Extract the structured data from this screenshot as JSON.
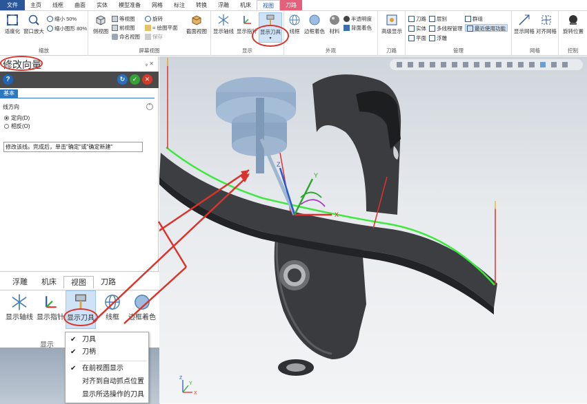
{
  "menu": {
    "tabs": [
      "文件",
      "主页",
      "线框",
      "曲面",
      "实体",
      "模型准备",
      "网格",
      "标注",
      "转换",
      "浮雕",
      "机床",
      "视图",
      "刀路"
    ],
    "active": "视图"
  },
  "ribbon": {
    "zoom": {
      "name": "缩放",
      "fit": "适度化",
      "window_zoom": "窗口放大",
      "shrink50": "缩小 50%",
      "shrink80": "缩小图形 80%"
    },
    "screen_view": {
      "name": "屏幕视图",
      "side": "侧视图",
      "iso": "等视图",
      "front": "前视图",
      "named": "命名视图",
      "rotate": "旋转",
      "plane": "= 绘图平面",
      "save": "保存",
      "section": "截面视图"
    },
    "display": {
      "name": "显示",
      "axis": "显示轴线",
      "indicator": "显示指针",
      "tool": "显示刀具"
    },
    "appearance": {
      "name": "外观",
      "wire": "线框",
      "edge_shade": "边框着色",
      "material": "材料",
      "translucent": "半透明度",
      "back_color": "背面着色"
    },
    "toolpath": {
      "name": "刀路",
      "advanced": "高级显示"
    },
    "manage": {
      "name": "管理",
      "toolpath": "刀路",
      "solid": "实体",
      "plane": "平面",
      "layer": "层别",
      "multi": "多线程管理",
      "relief": "浮雕",
      "group": "群组",
      "recent": "最近使用功能"
    },
    "grid": {
      "name": "网格",
      "show": "显示网格",
      "align": "对齐网格"
    },
    "control": {
      "name": "控制",
      "rotate_pos": "旋转位置"
    }
  },
  "panel": {
    "title": "修改向量",
    "pin": "ᵩ ✕",
    "tab": "基本",
    "section": "线方向",
    "opt1": "定向(D)",
    "opt2": "相反(O)",
    "hint": "修改该线。完成后，单击\"确定\"或\"确定新建\""
  },
  "inset": {
    "tabs": [
      "浮雕",
      "机床",
      "视图",
      "刀路"
    ],
    "active": "视图",
    "btn_axis": "显示轴线",
    "btn_indicator": "显示指针",
    "btn_tool": "显示刀具",
    "btn_wire": "线框",
    "btn_edge": "边框着色",
    "group": "显示"
  },
  "dropdown": {
    "items": [
      {
        "label": "刀具",
        "checked": true
      },
      {
        "label": "刀柄",
        "checked": true
      },
      {
        "label": "在前视图显示",
        "checked": true
      },
      {
        "label": "对齐到自动抓点位置",
        "checked": false
      },
      {
        "label": "显示所选操作的刀具",
        "checked": false
      }
    ]
  },
  "viewport": {
    "axis_x": "X",
    "axis_y": "Y",
    "axis_z": "Z"
  },
  "colors": {
    "file_tab": "#2b579a",
    "toolpath_tab": "#e35f7a",
    "annotation_red": "#d9342b",
    "curve_green": "#3ee83e"
  }
}
